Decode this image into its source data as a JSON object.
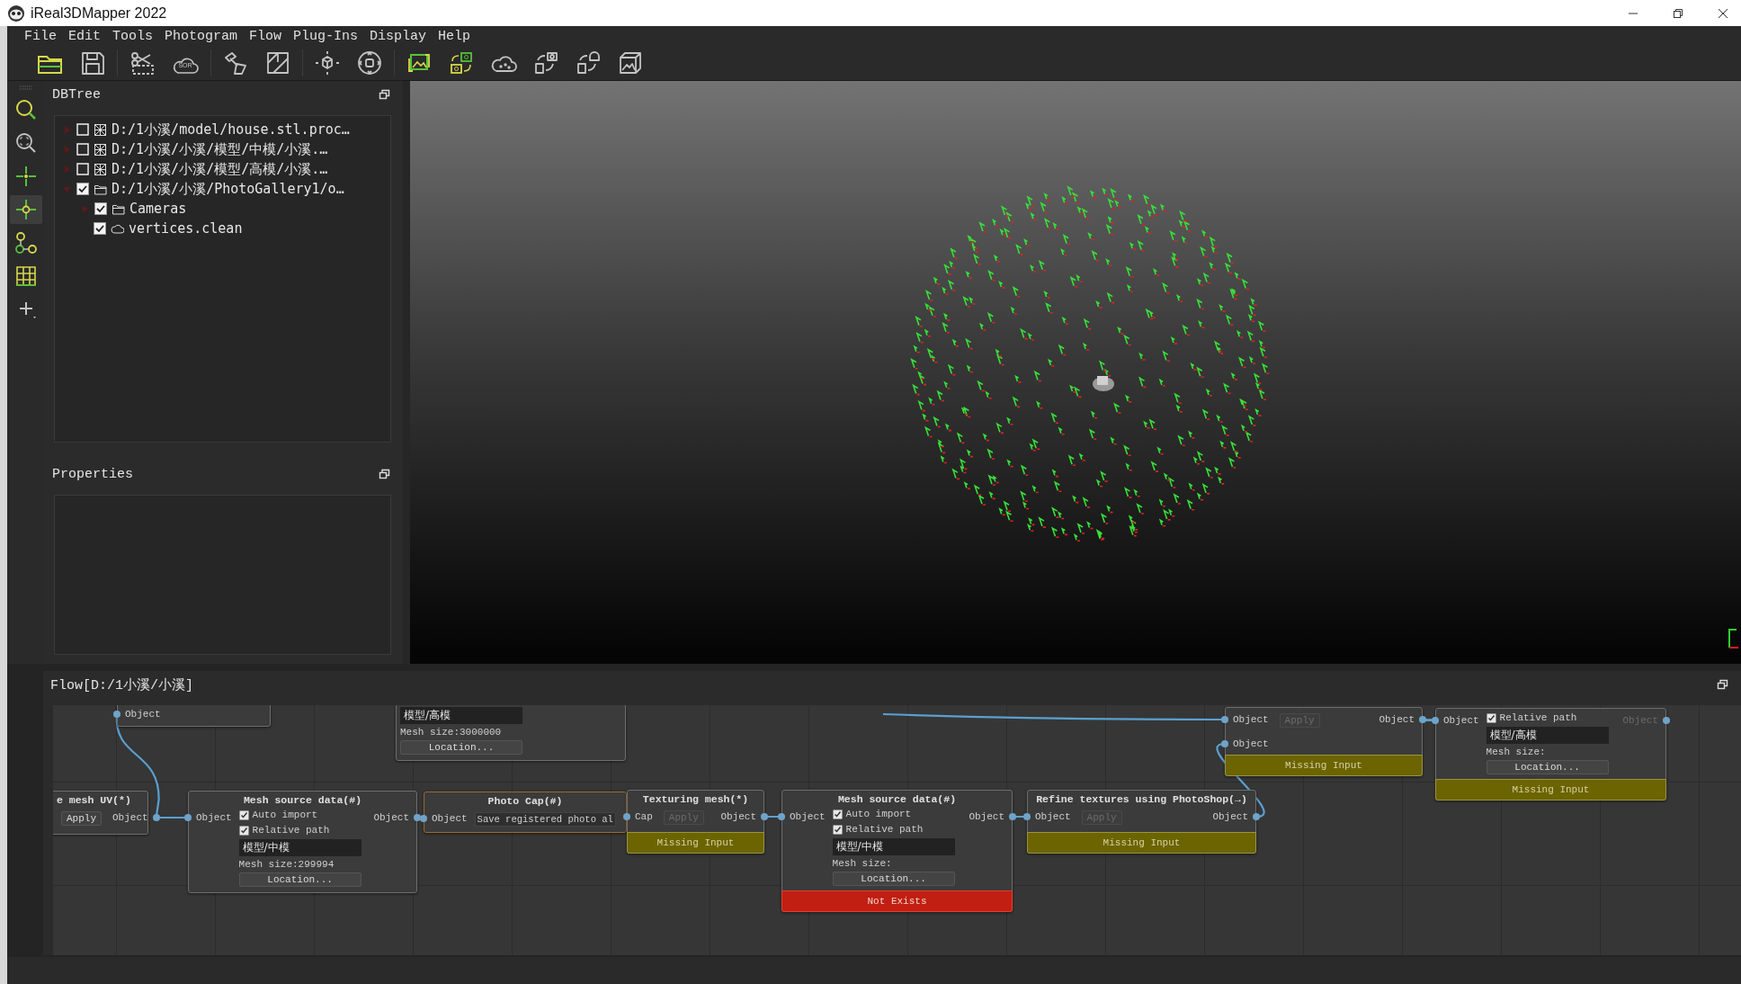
{
  "window": {
    "title": "iReal3DMapper 2022"
  },
  "menu": [
    "File",
    "Edit",
    "Tools",
    "Photogram",
    "Flow",
    "Plug-Ins",
    "Display",
    "Help"
  ],
  "toolbar": {
    "sor_label": "SOR"
  },
  "side_tools": [
    {
      "selected": false
    },
    {
      "selected": false
    },
    {
      "selected": false
    },
    {
      "selected": true
    },
    {
      "selected": false
    },
    {
      "selected": false
    },
    {
      "selected": false
    }
  ],
  "dbtree": {
    "title": "DBTree",
    "items": [
      {
        "label": "D:/1小溪/model/house.stl.proc…",
        "kind": "mesh",
        "checked": false,
        "expanded": false
      },
      {
        "label": "D:/1小溪/小溪/模型/中模/小溪.…",
        "kind": "mesh",
        "checked": false,
        "expanded": false
      },
      {
        "label": "D:/1小溪/小溪/模型/高模/小溪.…",
        "kind": "mesh",
        "checked": false,
        "expanded": false
      },
      {
        "label": "D:/1小溪/小溪/PhotoGallery1/o…",
        "kind": "folder",
        "checked": true,
        "expanded": true,
        "children": [
          {
            "label": "Cameras",
            "kind": "folder",
            "checked": true,
            "expanded": false
          },
          {
            "label": "vertices.clean",
            "kind": "cloud",
            "checked": true
          }
        ]
      }
    ]
  },
  "properties": {
    "title": "Properties"
  },
  "flow": {
    "title": "Flow[D:/1小溪/小溪]",
    "nodes": [
      {
        "highlighted": false,
        "inputs": [
          {
            "label": "Object",
            "disabled": false
          }
        ]
      },
      {
        "highlighted": false,
        "path_field": "模型/高模",
        "mesh_size": "Mesh size:3000000",
        "location_button": "Location..."
      },
      {
        "highlighted": false,
        "title": "e mesh UV(*)",
        "apply": {
          "label": "Apply",
          "disabled": false
        },
        "outputs": [
          {
            "label": "Object",
            "disabled": false
          }
        ]
      },
      {
        "highlighted": false,
        "title": "Mesh source data(#)",
        "inputs": [
          {
            "label": "Object",
            "disabled": false
          }
        ],
        "outputs": [
          {
            "label": "Object",
            "disabled": false
          }
        ],
        "checkboxes": [
          {
            "label": "Auto import",
            "checked": true
          },
          {
            "label": "Relative path",
            "checked": true
          }
        ],
        "path_field": "模型/中模",
        "mesh_size": "Mesh size:299994",
        "location_button": "Location..."
      },
      {
        "highlighted": true,
        "title": "Photo Cap(#)",
        "inputs": [
          {
            "label": "Object",
            "disabled": false
          }
        ],
        "text_field": "Save registered photo al"
      },
      {
        "highlighted": false,
        "title": "Texturing mesh(*)",
        "inputs": [
          {
            "label": "Cap",
            "disabled": false
          }
        ],
        "apply": {
          "label": "Apply",
          "disabled": true
        },
        "outputs": [
          {
            "label": "Object",
            "disabled": false
          }
        ],
        "status": {
          "kind": "warning",
          "label": "Missing Input"
        }
      },
      {
        "highlighted": false,
        "title": "Mesh source data(#)",
        "inputs": [
          {
            "label": "Object",
            "disabled": false
          }
        ],
        "outputs": [
          {
            "label": "Object",
            "disabled": false
          }
        ],
        "checkboxes": [
          {
            "label": "Auto import",
            "checked": true
          },
          {
            "label": "Relative path",
            "checked": true
          }
        ],
        "path_field": "模型/中模",
        "mesh_size": "Mesh size:",
        "location_button": "Location...",
        "status": {
          "kind": "error",
          "label": "Not Exists"
        }
      },
      {
        "highlighted": false,
        "title": "Refine textures using PhotoShop(→)",
        "inputs": [
          {
            "label": "Object",
            "disabled": false
          }
        ],
        "apply": {
          "label": "Apply",
          "disabled": true
        },
        "outputs": [
          {
            "label": "Object",
            "disabled": false
          }
        ],
        "status": {
          "kind": "warning",
          "label": "Missing Input"
        }
      },
      {
        "highlighted": false,
        "inputs": [
          {
            "label": "Object",
            "disabled": false
          },
          {
            "label": "Object",
            "disabled": false
          }
        ],
        "apply": {
          "label": "Apply",
          "disabled": true
        },
        "outputs": [
          {
            "label": "Object",
            "disabled": false
          }
        ],
        "status": {
          "kind": "warning",
          "label": "Missing Input"
        }
      },
      {
        "highlighted": false,
        "inputs": [
          {
            "label": "Object",
            "disabled": false
          }
        ],
        "outputs": [
          {
            "label": "Object",
            "disabled": true
          }
        ],
        "checkboxes": [
          {
            "label": "Relative path",
            "checked": true
          }
        ],
        "path_field": "模型/高模",
        "mesh_size": "Mesh size:",
        "location_button": "Location...",
        "status": {
          "kind": "warning",
          "label": "Missing Input"
        }
      }
    ]
  }
}
